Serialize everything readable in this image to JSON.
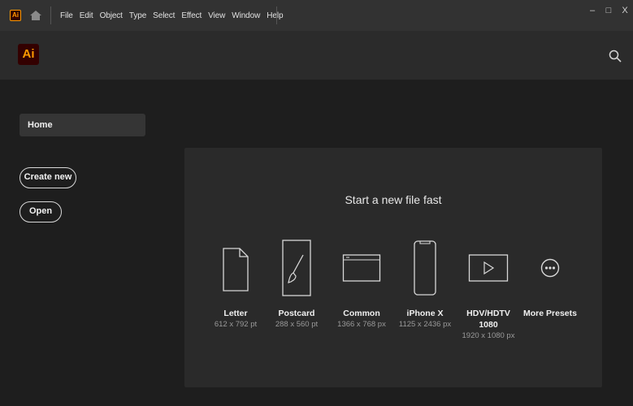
{
  "titlebar": {
    "app_badge": "Ai",
    "menu": [
      "File",
      "Edit",
      "Object",
      "Type",
      "Select",
      "Effect",
      "View",
      "Window",
      "Help"
    ],
    "window_controls": {
      "minimize": "–",
      "maximize": "□",
      "close": "X"
    }
  },
  "header": {
    "logo": "Ai",
    "search_icon": "search-icon"
  },
  "sidebar": {
    "home_label": "Home",
    "create_new_label": "Create new",
    "open_label": "Open"
  },
  "quickstart": {
    "title": "Start a new file fast",
    "presets": [
      {
        "name": "Letter",
        "dims": "612 x 792 pt",
        "icon": "letter-document-icon"
      },
      {
        "name": "Postcard",
        "dims": "288 x 560 pt",
        "icon": "postcard-brush-icon"
      },
      {
        "name": "Common",
        "dims": "1366 x 768 px",
        "icon": "browser-window-icon"
      },
      {
        "name": "iPhone X",
        "dims": "1125 x 2436 px",
        "icon": "phone-icon"
      },
      {
        "name": "HDV/HDTV",
        "name2": "1080",
        "dims": "1920 x 1080 px",
        "icon": "video-play-icon"
      },
      {
        "name": "More Presets",
        "dims": "",
        "icon": "more-ellipsis-icon"
      }
    ]
  },
  "colors": {
    "brand_bg": "#330000",
    "brand_fg": "#ff9a00",
    "app_bg": "#1e1e1e",
    "panel_bg": "#2a2a2a"
  }
}
